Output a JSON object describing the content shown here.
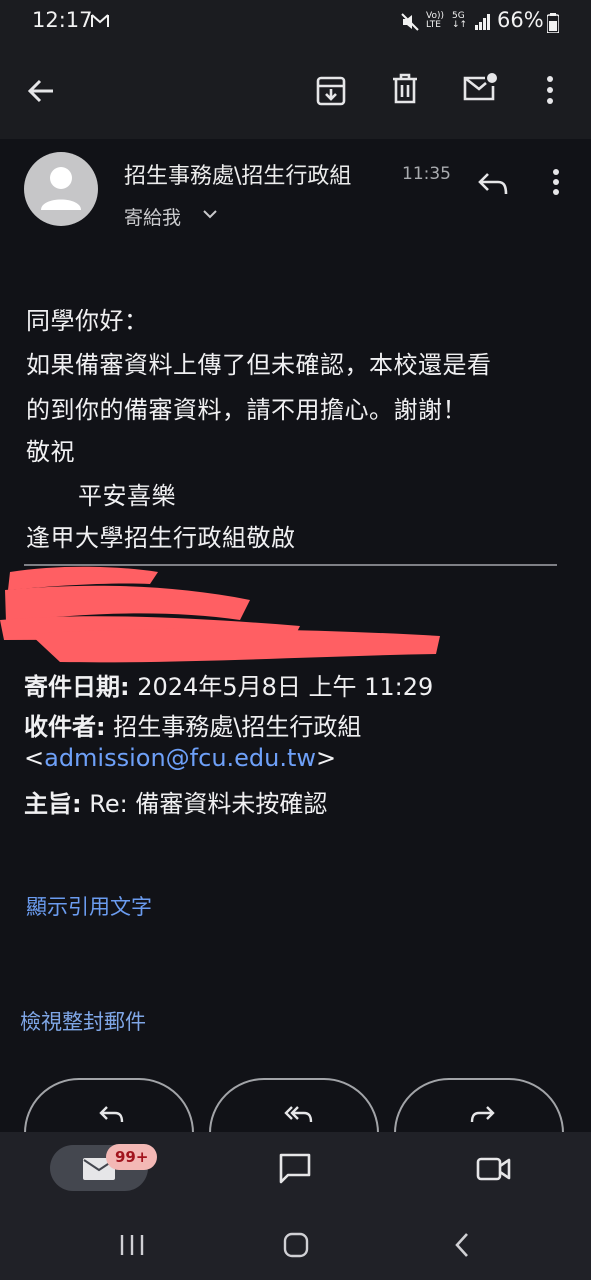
{
  "status_bar": {
    "time": "12:17",
    "net_a_top": "Vo))",
    "net_a_bottom": "LTE",
    "net_b_top": "5G",
    "net_b_bottom": "↓↑",
    "battery": "66%"
  },
  "toolbar": {
    "back_icon": "arrow-left-icon",
    "archive_icon": "archive-icon",
    "delete_icon": "trash-icon",
    "mark_unread_icon": "mail-unread-icon",
    "more_icon": "more-vertical-icon"
  },
  "email": {
    "sender": "招生事務處\\招生行政組",
    "time": "11:35",
    "recipient_summary": "寄給我",
    "body_lines": [
      "同學你好：",
      "如果備審資料上傳了但未確認，本校還是看",
      "的到你的備審資料，請不用擔心。謝謝！",
      "敬祝",
      "平安喜樂",
      "逢甲大學招生行政組敬啟"
    ],
    "quoted": {
      "date_label": "寄件日期:",
      "date_value": "2024年5月8日 上午 11:29",
      "to_label": "收件者:",
      "to_name": "招生事務處\\招生行政組",
      "to_email_open": "<",
      "to_email": "admission@fcu.edu.tw",
      "to_email_close": ">",
      "subject_label": "主旨:",
      "subject_value": "Re: 備審資料未按確認"
    },
    "show_quoted_text": "顯示引用文字",
    "view_entire_message": "檢視整封郵件"
  },
  "actions": {
    "reply_icon": "reply-icon",
    "reply_all_icon": "reply-all-icon",
    "forward_icon": "forward-icon"
  },
  "bottom_nav": {
    "mail_badge": "99+",
    "mail_icon": "mail-icon",
    "chat_icon": "chat-icon",
    "meet_icon": "video-icon"
  },
  "colors": {
    "background": "#111217",
    "link": "#6b9cf0",
    "badge": "#f3b8b5",
    "scribble": "#ff5f63"
  }
}
